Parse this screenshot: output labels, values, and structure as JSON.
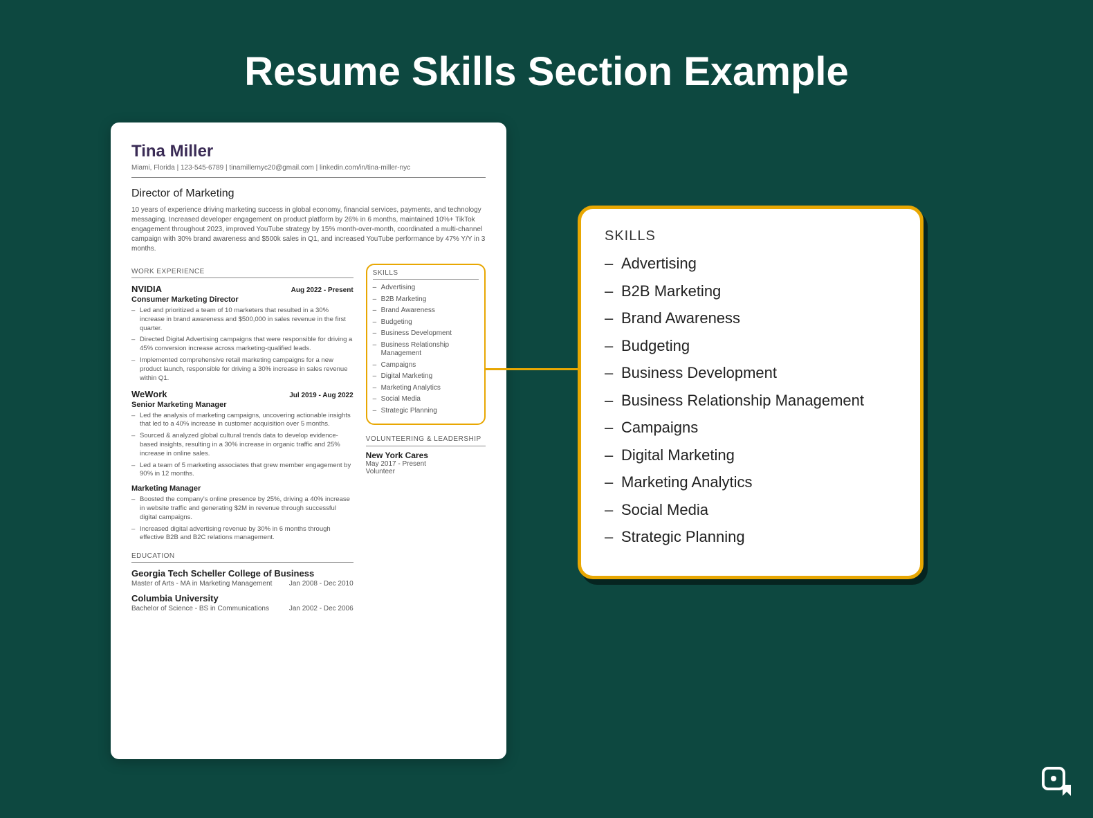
{
  "page_title": "Resume Skills Section Example",
  "resume": {
    "name": "Tina Miller",
    "contact": "Miami, Florida | 123-545-6789 | tinamillernyc20@gmail.com | linkedin.com/in/tina-miller-nyc",
    "role": "Director of Marketing",
    "summary": "10 years of experience driving marketing success in global economy, financial services, payments, and technology messaging. Increased developer engagement on product platform by 26% in 6 months, maintained 10%+ TikTok engagement throughout 2023, improved YouTube strategy by 15% month-over-month, coordinated a multi-channel campaign with 30% brand awareness and $500k sales in Q1, and increased YouTube performance by 47% Y/Y in 3 months.",
    "sections": {
      "work": "WORK EXPERIENCE",
      "skills": "SKILLS",
      "vol": "VOLUNTEERING & LEADERSHIP",
      "edu": "EDUCATION"
    },
    "jobs": [
      {
        "company": "NVIDIA",
        "dates": "Aug 2022 - Present",
        "title": "Consumer Marketing Director",
        "bullets": [
          "Led and prioritized a team of 10 marketers that resulted in a 30% increase in brand awareness and $500,000 in sales revenue in the first quarter.",
          "Directed Digital Advertising campaigns that were responsible for driving a 45% conversion increase across marketing-qualified leads.",
          "Implemented comprehensive retail marketing campaigns for a new product launch, responsible for driving a 30% increase in sales revenue within Q1."
        ]
      },
      {
        "company": "WeWork",
        "dates": "Jul 2019 - Aug 2022",
        "title": "Senior Marketing Manager",
        "bullets": [
          "Led the analysis of marketing campaigns, uncovering actionable insights that led to a 40% increase in customer acquisition over 5 months.",
          "Sourced & analyzed global cultural trends data to develop evidence-based insights, resulting in a 30% increase in organic traffic and 25% increase in online sales.",
          "Led a team of 5 marketing associates that grew member engagement by 90% in 12 months."
        ]
      },
      {
        "company": "",
        "dates": "",
        "title": "Marketing Manager",
        "bullets": [
          "Boosted the company's online presence by 25%, driving a 40% increase in website traffic and generating $2M in revenue through successful digital campaigns.",
          "Increased digital advertising revenue by 30% in 6 months through effective B2B and B2C relations management."
        ]
      }
    ],
    "skills": [
      "Advertising",
      "B2B Marketing",
      "Brand Awareness",
      "Budgeting",
      "Business Development",
      "Business Relationship Management",
      "Campaigns",
      "Digital Marketing",
      "Marketing Analytics",
      "Social Media",
      "Strategic Planning"
    ],
    "volunteering": {
      "org": "New York Cares",
      "dates": "May 2017 - Present",
      "role": "Volunteer"
    },
    "education": [
      {
        "school": "Georgia Tech Scheller College of Business",
        "degree": "Master of Arts - MA in Marketing Management",
        "dates": "Jan 2008 - Dec 2010"
      },
      {
        "school": "Columbia University",
        "degree": "Bachelor of Science - BS in Communications",
        "dates": "Jan 2002 - Dec 2006"
      }
    ]
  },
  "callout": {
    "heading": "SKILLS",
    "items": [
      "Advertising",
      "B2B Marketing",
      "Brand Awareness",
      "Budgeting",
      "Business Development",
      "Business Relationship Management",
      "Campaigns",
      "Digital Marketing",
      "Marketing Analytics",
      "Social Media",
      "Strategic Planning"
    ]
  }
}
